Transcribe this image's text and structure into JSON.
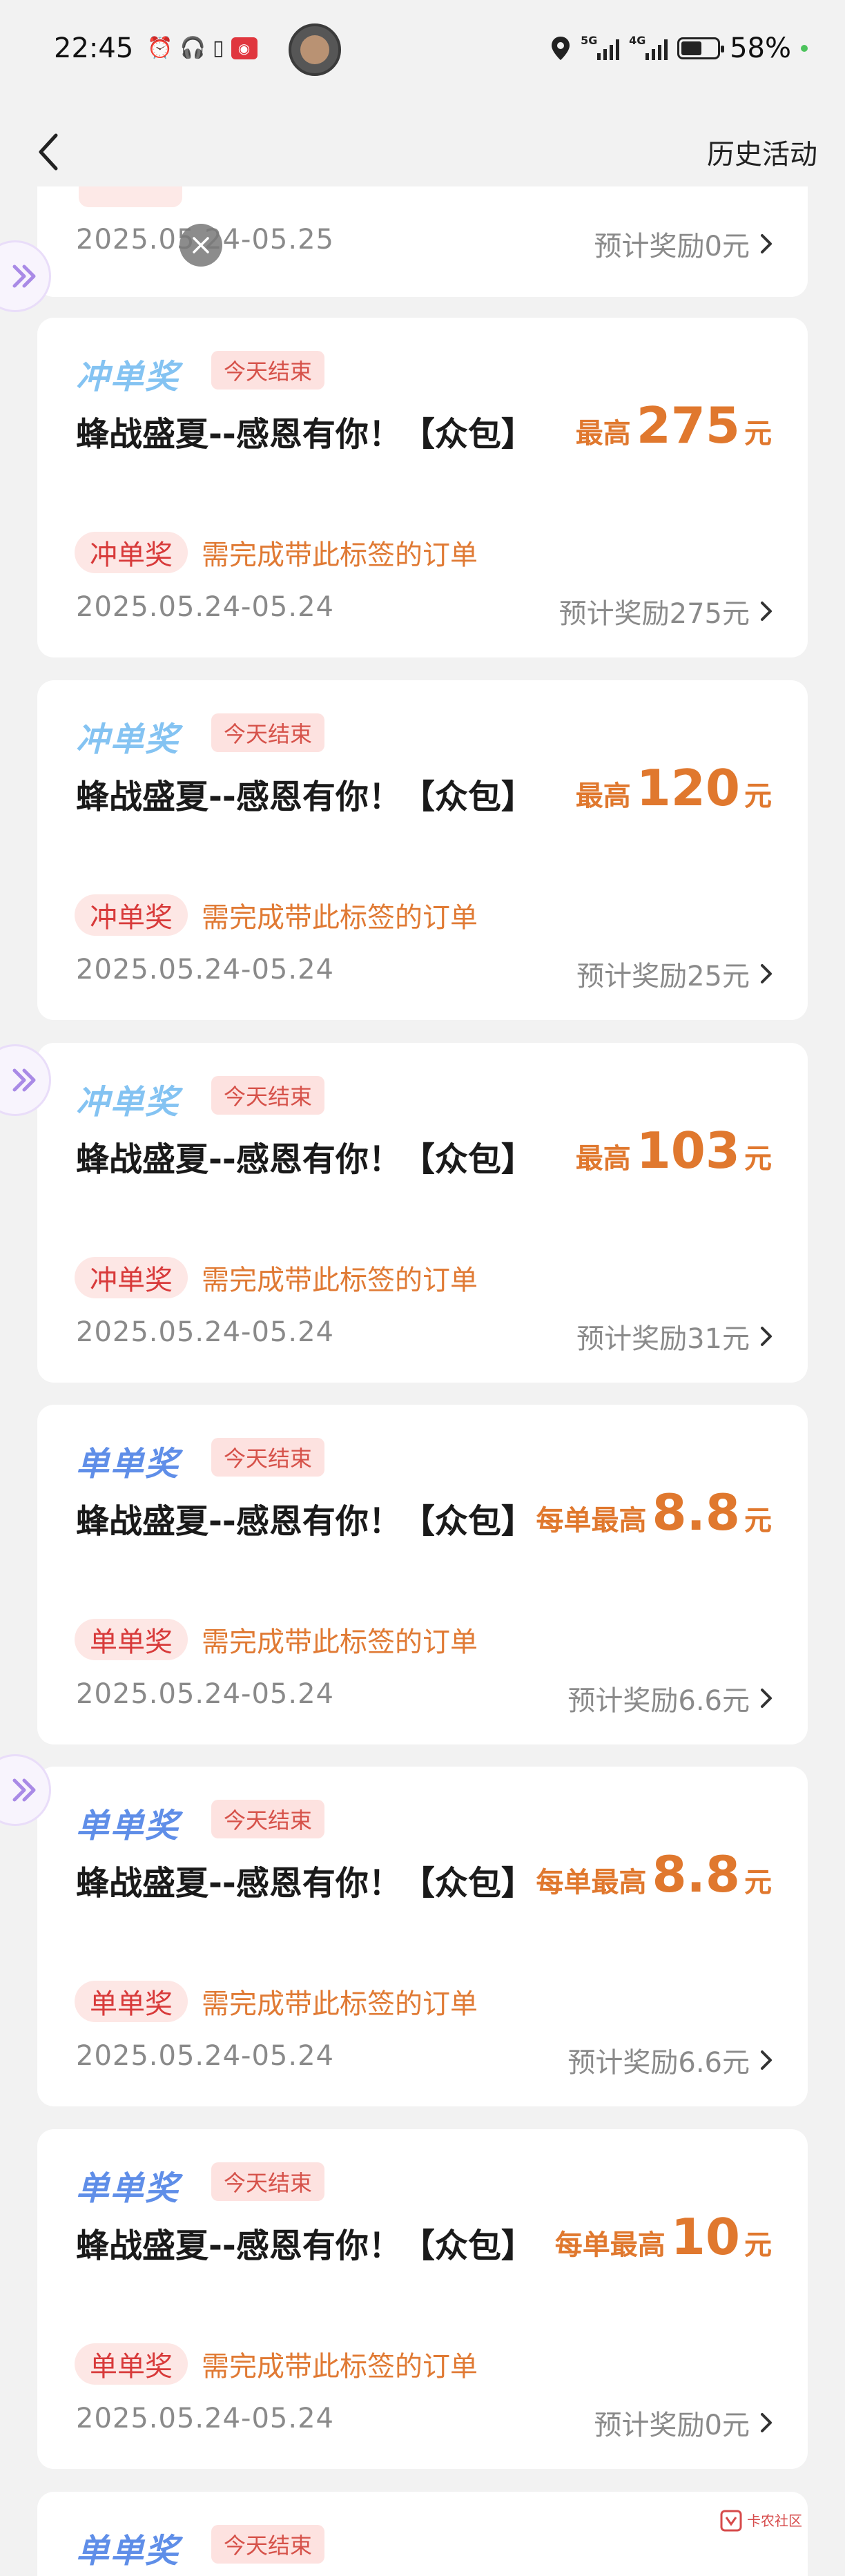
{
  "status_bar": {
    "time": "22:45",
    "signal1_label": "5G",
    "signal2_label": "4G",
    "battery_percent": "58%",
    "battery_level": 0.58
  },
  "nav": {
    "back_icon": "chevron-left-icon",
    "history_label": "历史活动"
  },
  "partial_card": {
    "date": "2025.05.24-05.25",
    "estimate": "预计奖励0元"
  },
  "cards": [
    {
      "type": "冲单奖",
      "ends": "今天结束",
      "title": "蜂战盛夏--感恩有你！【众包】",
      "reward_prefix": "最高",
      "reward_value": "275",
      "reward_unit": "元",
      "pill": "冲单奖",
      "note": "需完成带此标签的订单",
      "date": "2025.05.24-05.24",
      "estimate": "预计奖励275元"
    },
    {
      "type": "冲单奖",
      "ends": "今天结束",
      "title": "蜂战盛夏--感恩有你！【众包】",
      "reward_prefix": "最高",
      "reward_value": "120",
      "reward_unit": "元",
      "pill": "冲单奖",
      "note": "需完成带此标签的订单",
      "date": "2025.05.24-05.24",
      "estimate": "预计奖励25元"
    },
    {
      "type": "冲单奖",
      "ends": "今天结束",
      "title": "蜂战盛夏--感恩有你！【众包】",
      "reward_prefix": "最高",
      "reward_value": "103",
      "reward_unit": "元",
      "pill": "冲单奖",
      "note": "需完成带此标签的订单",
      "date": "2025.05.24-05.24",
      "estimate": "预计奖励31元"
    },
    {
      "type": "单单奖",
      "ends": "今天结束",
      "title": "蜂战盛夏--感恩有你！【众包】",
      "reward_prefix": "每单最高",
      "reward_value": "8.8",
      "reward_unit": "元",
      "pill": "单单奖",
      "note": "需完成带此标签的订单",
      "date": "2025.05.24-05.24",
      "estimate": "预计奖励6.6元"
    },
    {
      "type": "单单奖",
      "ends": "今天结束",
      "title": "蜂战盛夏--感恩有你！【众包】",
      "reward_prefix": "每单最高",
      "reward_value": "8.8",
      "reward_unit": "元",
      "pill": "单单奖",
      "note": "需完成带此标签的订单",
      "date": "2025.05.24-05.24",
      "estimate": "预计奖励6.6元"
    },
    {
      "type": "单单奖",
      "ends": "今天结束",
      "title": "蜂战盛夏--感恩有你！【众包】",
      "reward_prefix": "每单最高",
      "reward_value": "10",
      "reward_unit": "元",
      "pill": "单单奖",
      "note": "需完成带此标签的订单",
      "date": "2025.05.24-05.24",
      "estimate": "预计奖励0元"
    },
    {
      "type": "单单奖",
      "ends": "今天结束"
    }
  ],
  "watermark_text": "卡农社区",
  "colors": {
    "reward_orange": "#e0782e",
    "pill_red": "#d83a3a",
    "tag_light_blue": "#84c3f2",
    "tag_blue": "#5f8ee8",
    "badge_bg": "#fde2e0"
  }
}
